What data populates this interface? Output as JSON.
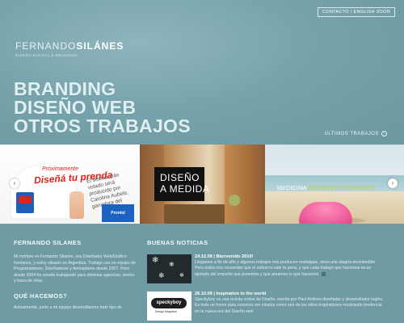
{
  "topnav": {
    "contact": "CONTACTO",
    "separator": "|",
    "english": "ENGLISH SOON"
  },
  "brand": {
    "name_light": "FERNANDO",
    "name_bold": "SILÁNES",
    "subtitle": "DISEÑO DIGITAL & BRANDING"
  },
  "headline": {
    "line1": "BRANDING",
    "line2": "DISEÑO WEB",
    "line3": "OTROS TRABAJOS"
  },
  "recent_link": {
    "label": "ÚLTIMOS TRABAJOS",
    "icon": "arrow-circle-icon"
  },
  "slider": {
    "prev_icon": "‹",
    "next_icon": "›",
    "slide1": {
      "line1": "Próximamente",
      "line2": "Diseñá tu prenda",
      "blurb": "El diseño más votado será producido por Carolina Aubele, ganadora del",
      "box": "Prontol"
    },
    "slide2": {
      "line1": "DISEÑO",
      "line2": "A MEDIDA"
    },
    "slide3": {
      "word1": "MEDICINA",
      "word2": "ANTIENVEJECIMIENTO"
    }
  },
  "about": {
    "title": "FERNANDO SILANES",
    "text": "Mi nombre es Fernando Silanes, soy Diseñador Web/Gráfico freelance, y estoy situado en Argentina. Trabajo con un equipo de Programadores, Diseñadores y Animadores desde 2007. Pero desde 2004 he estado trabajando para distintas agencias, dentro y fuera de ellas."
  },
  "what": {
    "title": "QUÉ HACEMOS?",
    "text": "Actualmente, junto a mi equipo desarrollamos todo tipo de"
  },
  "news": {
    "title": "BUENAS NOTICIAS",
    "items": [
      {
        "heading": "24.12.09 | Bienvenido 2010!",
        "text": "Llegamos a fin de año y algunos trabajos nos producen nostalgias, otros una alegría incontenible. Pero todos nos recuerdan que el esfuerzo vale la pena, y que cada trabajo que hacemos es un ejemplo del empeño que ponemos y que amamos lo que hacemos."
      },
      {
        "heading": "26.10.09 | Inspiration to the world",
        "text": "Speckyboy es una revista online de Diseño, escrita por Paul Andrew diseñador y desarrollador inglés. Es todo un honor para nosotros ser citados como uno de los sitios inspiradores mostrando tendencia en la nueva era del Diseño web",
        "thumb_logo": "speckyboy",
        "thumb_tag": "Design Magazine"
      }
    ]
  },
  "colors": {
    "background": "#6e9aa4",
    "accent_red": "#e2231a",
    "accent_green": "#b4d234"
  }
}
